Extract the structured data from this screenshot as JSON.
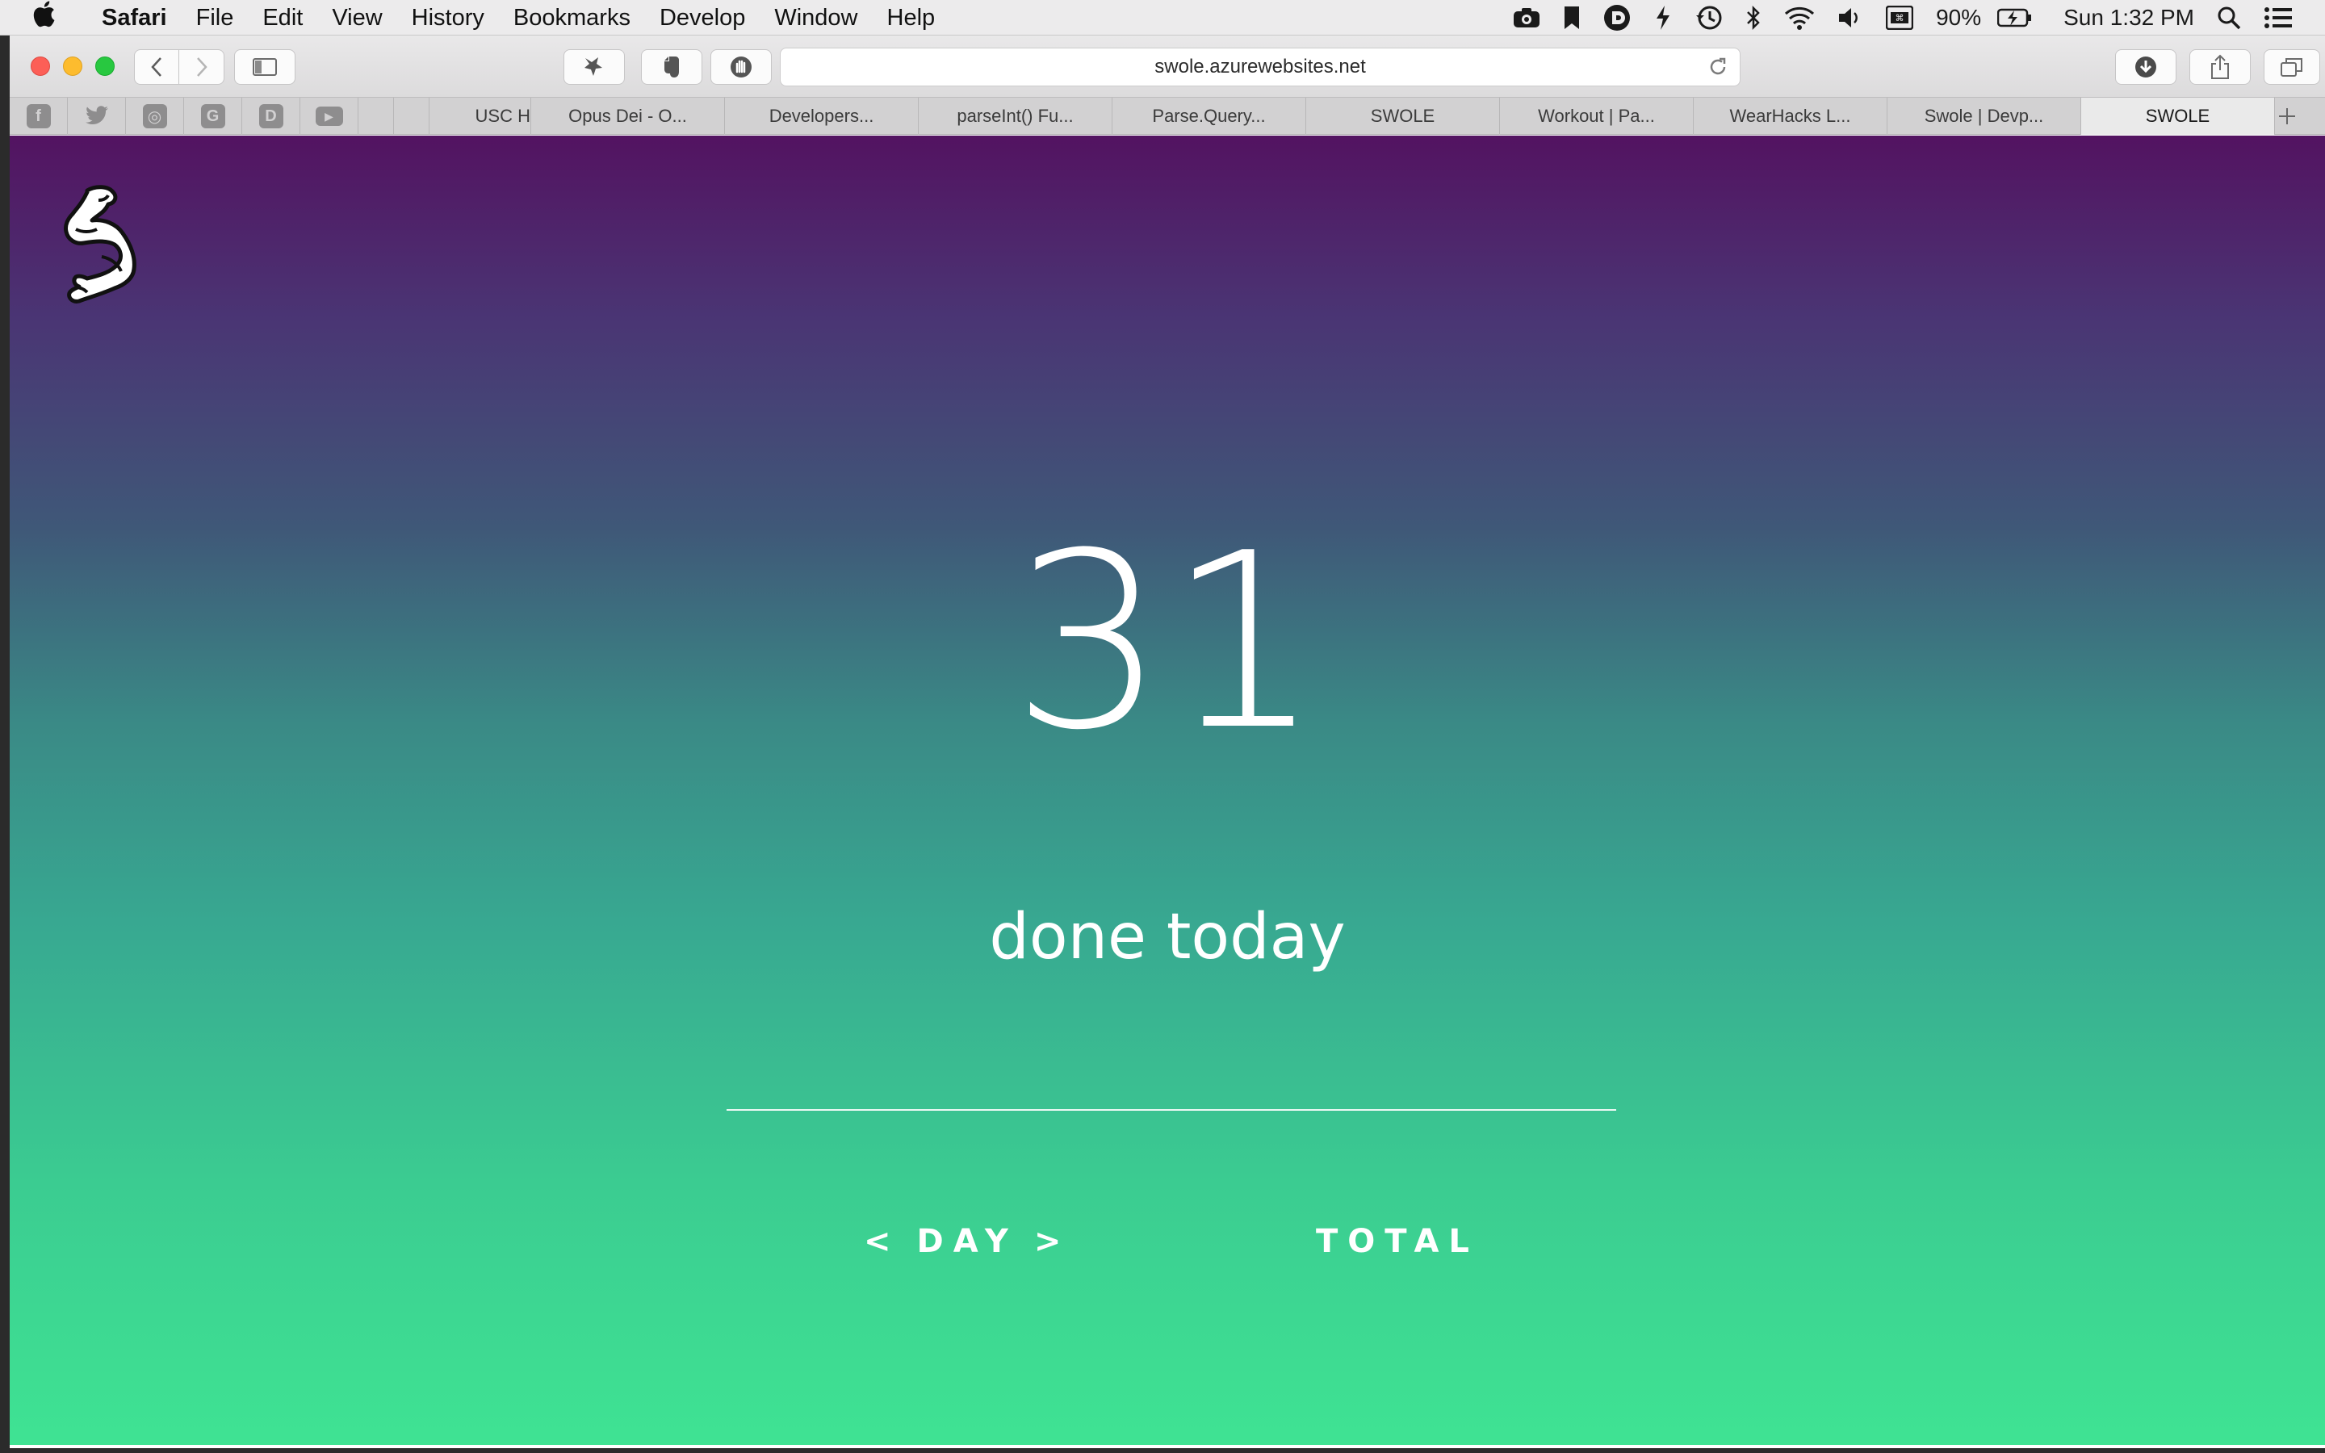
{
  "menubar": {
    "app_name": "Safari",
    "items": [
      "File",
      "Edit",
      "View",
      "History",
      "Bookmarks",
      "Develop",
      "Window",
      "Help"
    ],
    "battery": "90%",
    "clock": "Sun 1:32 PM"
  },
  "toolbar": {
    "url": "swole.azurewebsites.net"
  },
  "pinned_tabs": [
    {
      "icon": "facebook-icon",
      "glyph": "f"
    },
    {
      "icon": "twitter-icon",
      "glyph": "t"
    },
    {
      "icon": "instagram-icon",
      "glyph": "◎"
    },
    {
      "icon": "google-icon",
      "glyph": "G"
    },
    {
      "icon": "d-icon",
      "glyph": "D"
    },
    {
      "icon": "youtube-icon",
      "glyph": "▶"
    }
  ],
  "tabs": [
    "USC H",
    "Opus Dei - O...",
    "Developers...",
    "parseInt() Fu...",
    "Parse.Query...",
    "SWOLE",
    "Workout | Pa...",
    "WearHacks L...",
    "Swole | Devp...",
    "SWOLE"
  ],
  "active_tab_index": 9,
  "page": {
    "count": "31",
    "subtitle": "done today",
    "nav_left": "<",
    "period": "DAY",
    "nav_right": ">",
    "total_label": "TOTAL"
  },
  "colors": {
    "gradient_top": "#531361",
    "gradient_bottom": "#3fe393",
    "text": "#ffffff"
  }
}
